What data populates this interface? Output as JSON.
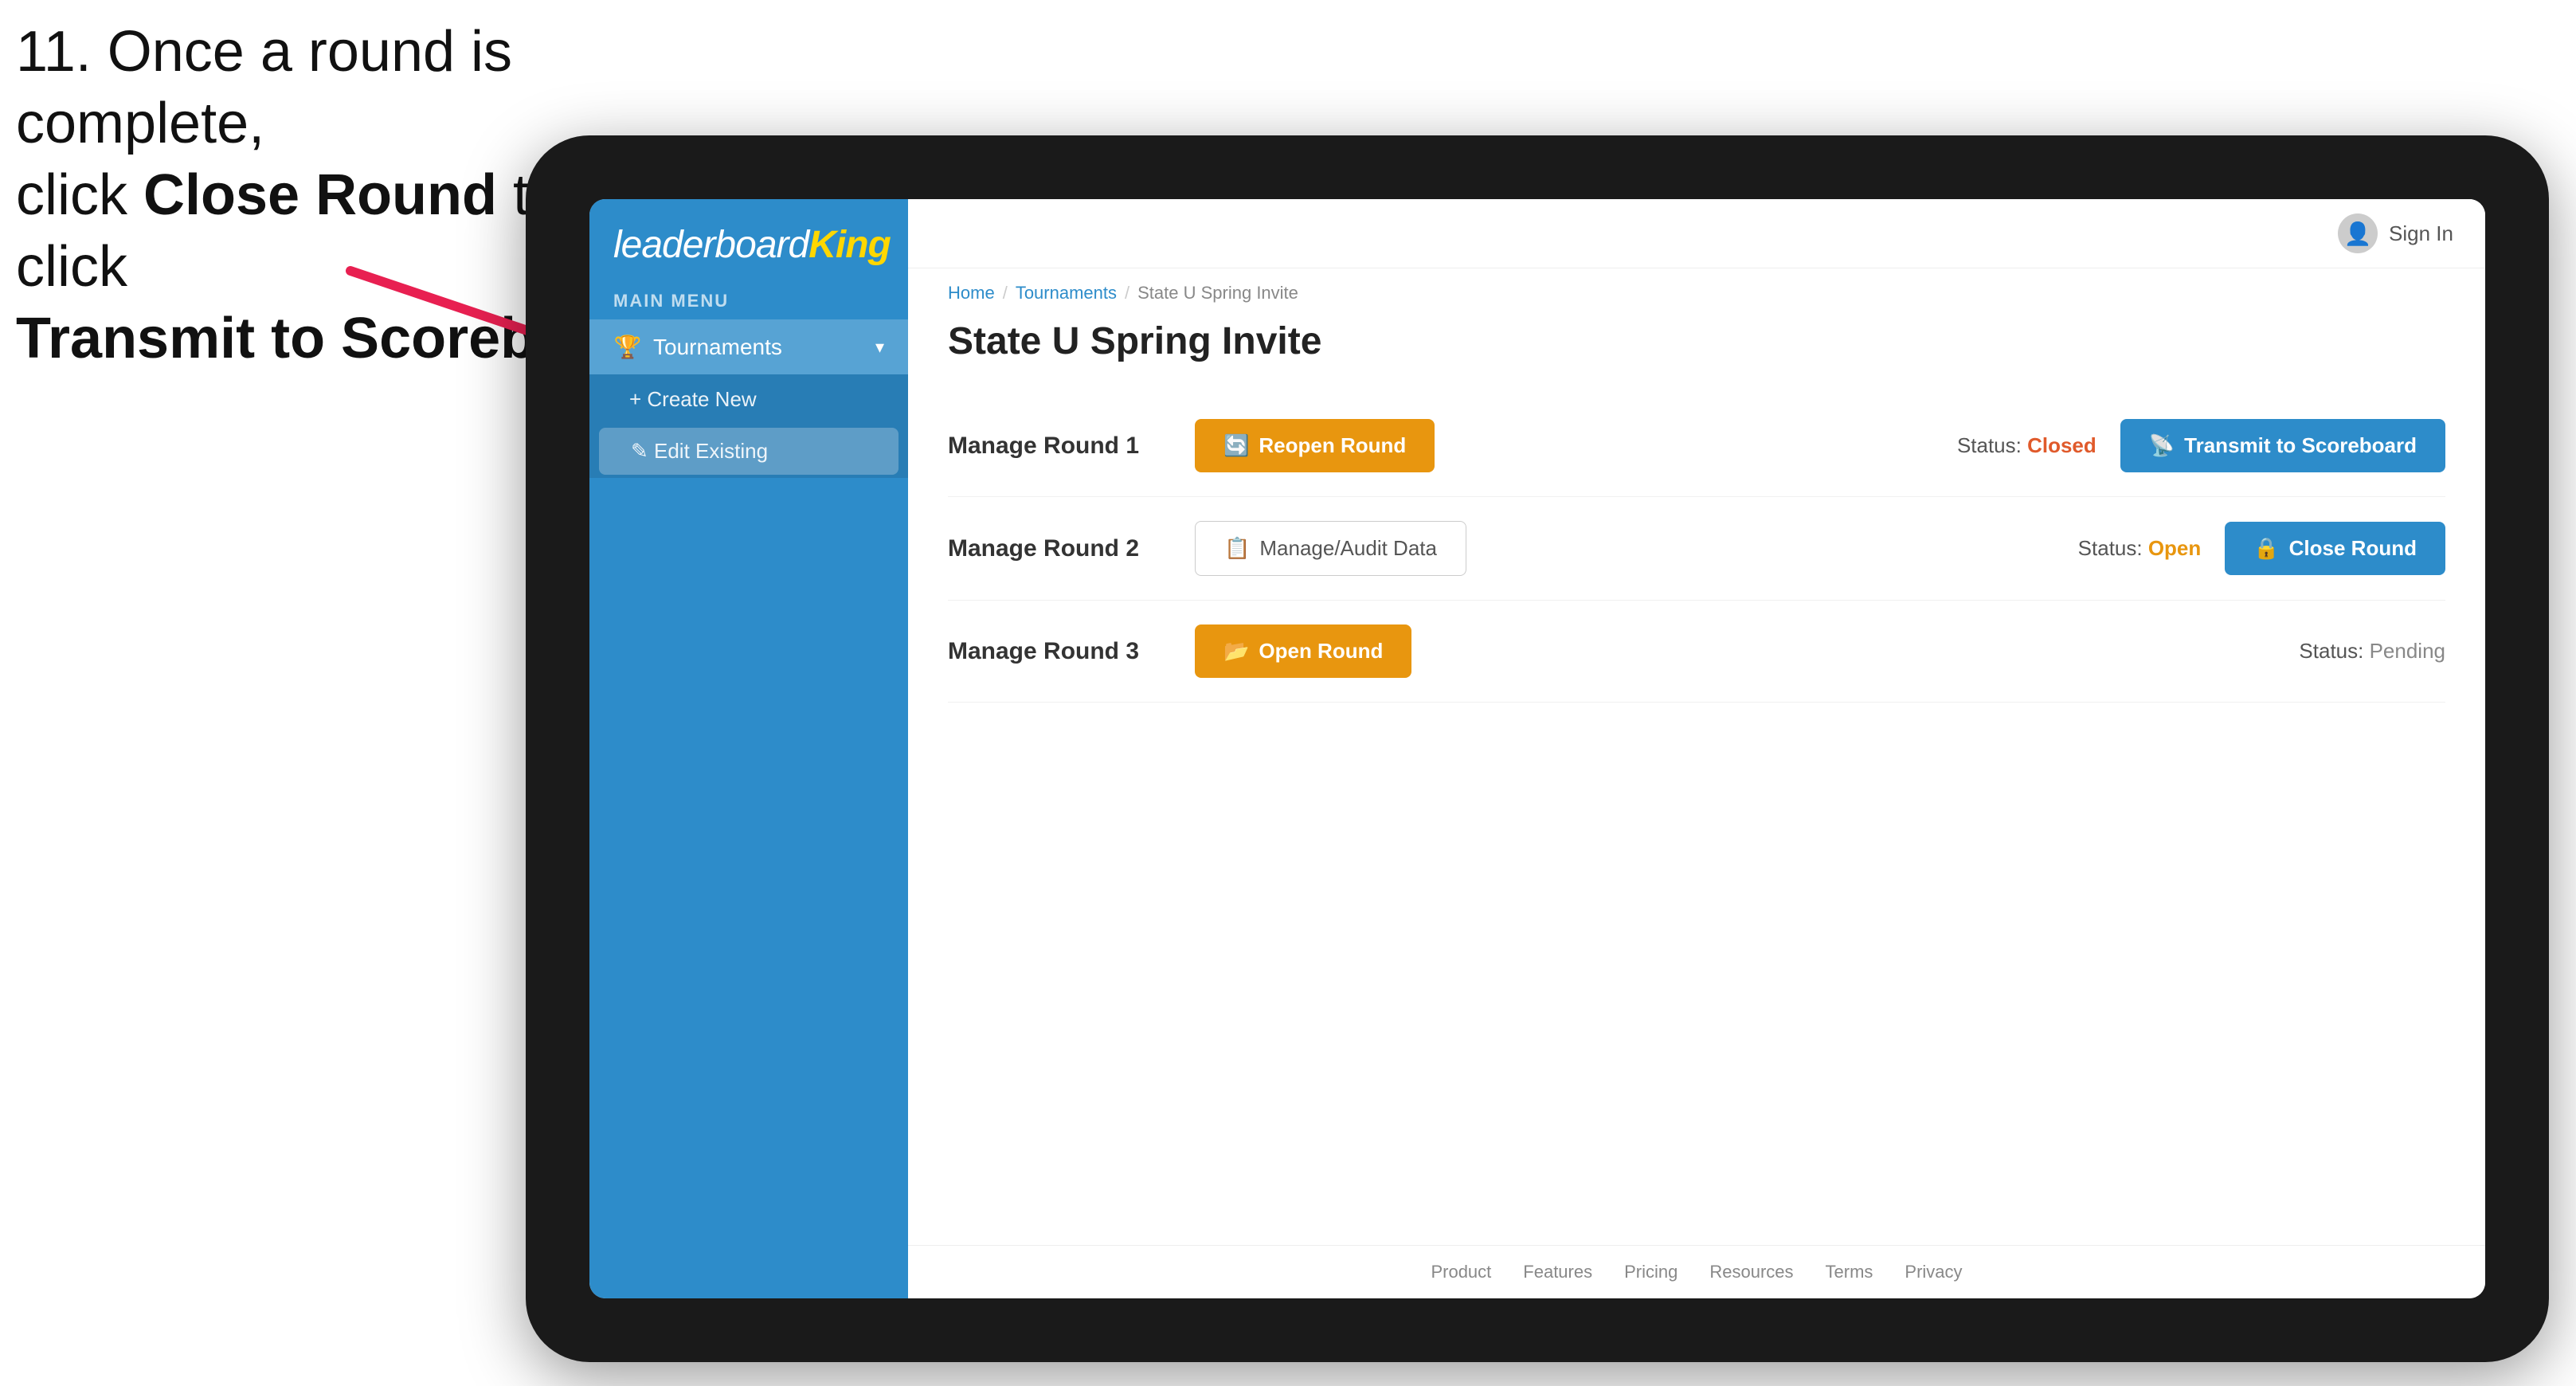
{
  "instruction": {
    "line1": "11. Once a round is complete,",
    "line2": "click ",
    "bold1": "Close Round",
    "line3": " then click",
    "bold2": "Transmit to Scoreboard."
  },
  "logo": {
    "leaderboard": "leaderboard",
    "king": "King"
  },
  "sidebar": {
    "main_menu_label": "MAIN MENU",
    "nav_items": [
      {
        "label": "Tournaments",
        "icon": "🏆",
        "expanded": true
      }
    ],
    "sub_items": [
      {
        "label": "+ Create New"
      },
      {
        "label": "✎ Edit Existing",
        "selected": true
      }
    ]
  },
  "topbar": {
    "sign_in": "Sign In"
  },
  "breadcrumb": {
    "home": "Home",
    "tournaments": "Tournaments",
    "current": "State U Spring Invite"
  },
  "page_title": "State U Spring Invite",
  "rounds": [
    {
      "id": "round1",
      "title": "Manage Round 1",
      "status_label": "Status:",
      "status_value": "Closed",
      "status_class": "status-closed",
      "button1_label": "Reopen Round",
      "button1_class": "btn-amber",
      "button1_icon": "🔄",
      "button2_label": "Transmit to Scoreboard",
      "button2_class": "btn-blue",
      "button2_icon": "📡"
    },
    {
      "id": "round2",
      "title": "Manage Round 2",
      "status_label": "Status:",
      "status_value": "Open",
      "status_class": "status-open",
      "button1_label": "Manage/Audit Data",
      "button1_class": "btn-outline",
      "button1_icon": "📋",
      "button2_label": "Close Round",
      "button2_class": "btn-blue",
      "button2_icon": "🔒"
    },
    {
      "id": "round3",
      "title": "Manage Round 3",
      "status_label": "Status:",
      "status_value": "Pending",
      "status_class": "status-pending",
      "button1_label": "Open Round",
      "button1_class": "btn-amber",
      "button1_icon": "📂",
      "button2_label": null
    }
  ],
  "footer": {
    "links": [
      "Product",
      "Features",
      "Pricing",
      "Resources",
      "Terms",
      "Privacy"
    ]
  }
}
